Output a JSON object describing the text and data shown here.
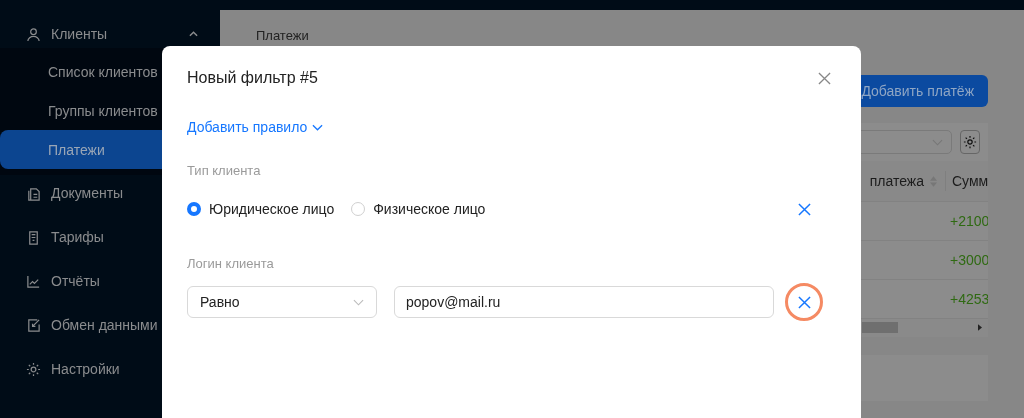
{
  "sidebar": {
    "items": [
      {
        "label": "Клиенты",
        "expanded": true,
        "children": [
          {
            "label": "Список клиентов",
            "selected": false
          },
          {
            "label": "Группы клиентов",
            "selected": false
          },
          {
            "label": "Платежи",
            "selected": true
          }
        ]
      },
      {
        "label": "Документы"
      },
      {
        "label": "Тарифы"
      },
      {
        "label": "Отчёты"
      },
      {
        "label": "Обмен данными"
      },
      {
        "label": "Настройки"
      }
    ]
  },
  "main": {
    "breadcrumb": "Платежи",
    "add_button": "Добавить платёж",
    "table": {
      "columns": [
        "платежа",
        "Сумм"
      ],
      "rows": [
        {
          "amount": "+2100"
        },
        {
          "amount": "+3000"
        },
        {
          "amount": "+4253"
        }
      ]
    }
  },
  "modal": {
    "title": "Новый фильтр #5",
    "add_rule": "Добавить правило",
    "rules": [
      {
        "kind": "radio",
        "label": "Тип клиента",
        "options": [
          {
            "label": "Юридическое лицо",
            "selected": true
          },
          {
            "label": "Физическое лицо",
            "selected": false
          }
        ],
        "highlighted": false
      },
      {
        "kind": "condition",
        "label": "Логин клиента",
        "operator": "Равно",
        "value": "popov@mail.ru",
        "highlighted": true
      }
    ]
  }
}
